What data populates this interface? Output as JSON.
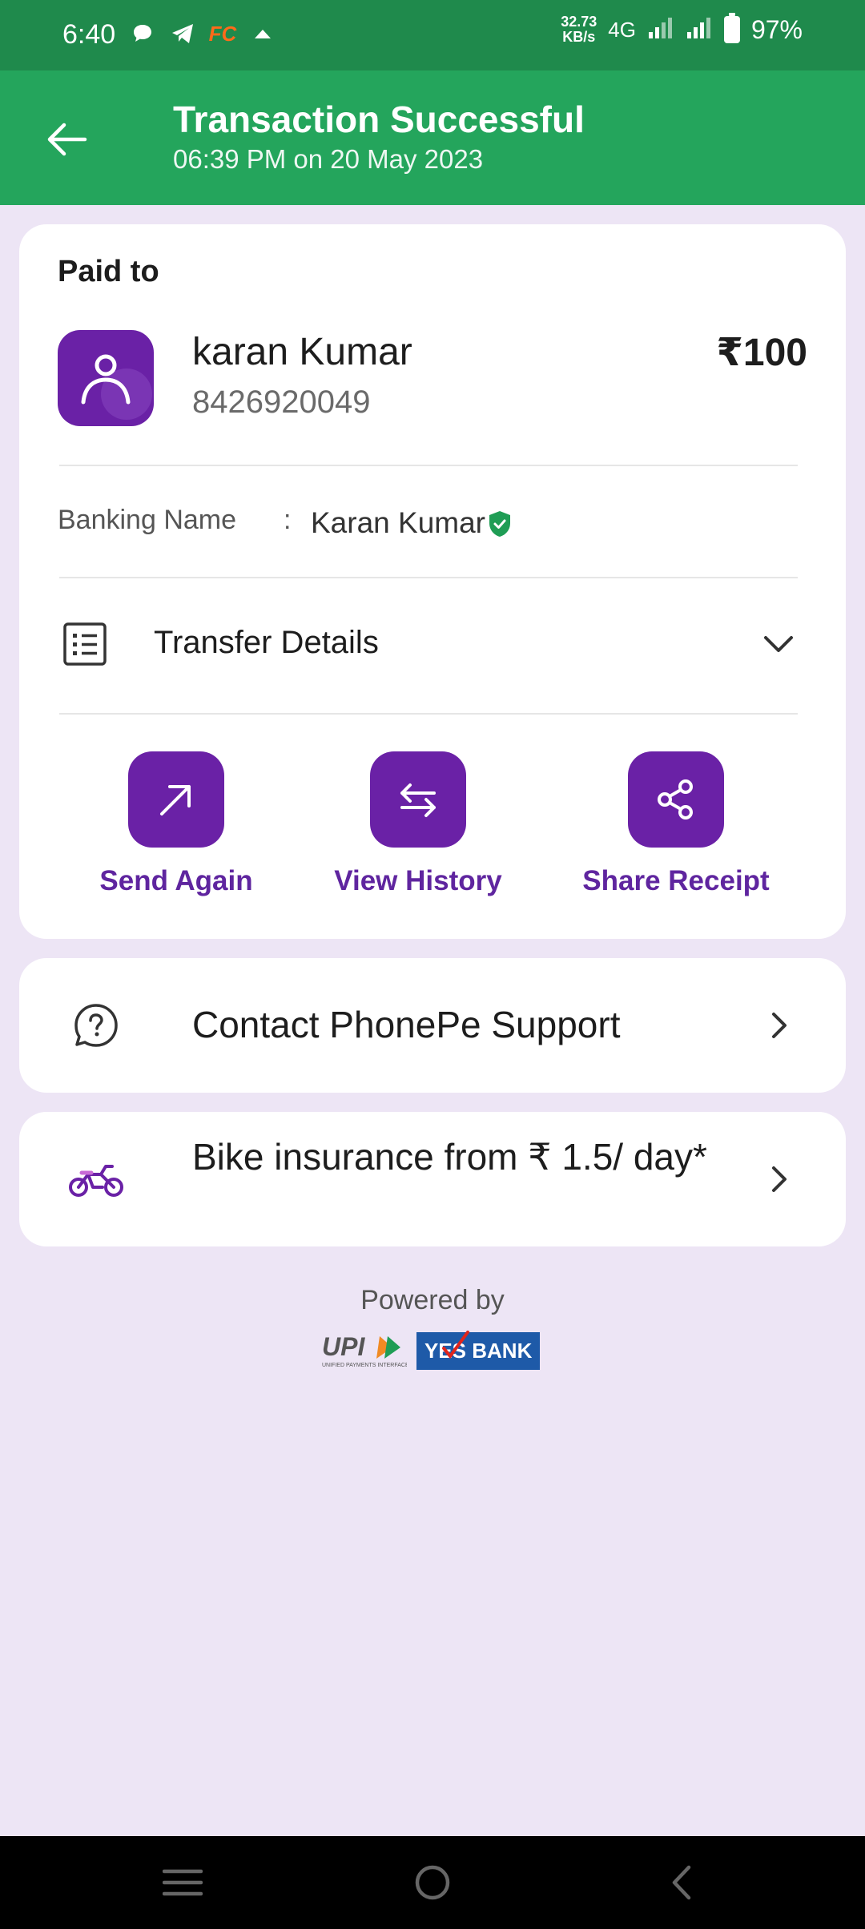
{
  "status_bar": {
    "time": "6:40",
    "fc_label": "FC",
    "net_speed_value": "32.73",
    "net_speed_unit": "KB/s",
    "network": "4G",
    "battery": "97%"
  },
  "header": {
    "title": "Transaction Successful",
    "subtitle": "06:39 PM on 20 May 2023"
  },
  "payment": {
    "paid_to_label": "Paid to",
    "payee_name": "karan Kumar",
    "payee_phone": "8426920049",
    "amount": "₹100",
    "banking_name_label": "Banking Name",
    "colon": ":",
    "banking_name": "Karan Kumar",
    "transfer_details_label": "Transfer Details"
  },
  "actions": [
    {
      "label": "Send Again",
      "icon": "arrow-up-right-icon"
    },
    {
      "label": "View History",
      "icon": "swap-arrows-icon"
    },
    {
      "label": "Share Receipt",
      "icon": "share-icon"
    }
  ],
  "support": {
    "label": "Contact PhonePe Support",
    "icon": "help-circle-icon"
  },
  "promo": {
    "label": "Bike insurance from ₹ 1.5/ day*",
    "icon": "bike-icon"
  },
  "footer": {
    "powered_by": "Powered by",
    "upi_logo": "UPI",
    "bank_logo": "YES BANK"
  },
  "colors": {
    "status_bar": "#1f8a4c",
    "header": "#24a55c",
    "accent_purple": "#6a21a6",
    "page_background": "#ede5f5"
  }
}
